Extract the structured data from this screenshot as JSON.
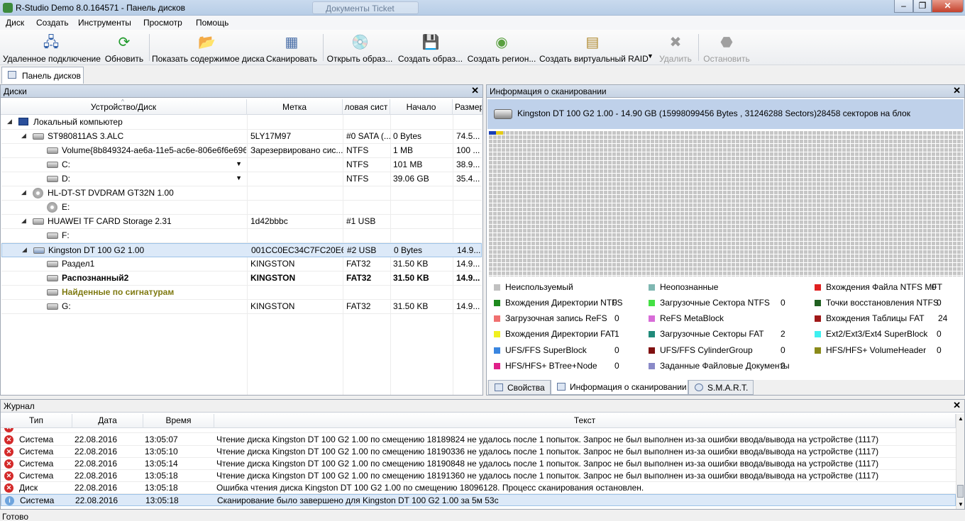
{
  "window": {
    "title": "R-Studio Demo 8.0.164571 - Панель дисков",
    "ghost_tab": "Документы Ticket",
    "controls": [
      "–",
      "❐",
      "✕"
    ]
  },
  "menu": [
    "Диск",
    "Создать",
    "Инструменты",
    "Просмотр",
    "Помощь"
  ],
  "toolbar": [
    {
      "label": "Удаленное подключение",
      "icon": "remote-computer-icon",
      "disabled": false
    },
    {
      "label": "Обновить",
      "icon": "refresh-icon",
      "disabled": false
    },
    {
      "label": "Показать содержимое диска",
      "icon": "open-folder-icon",
      "disabled": false
    },
    {
      "label": "Сканировать",
      "icon": "scan-icon",
      "disabled": false
    },
    {
      "label": "Открыть образ...",
      "icon": "open-image-icon",
      "disabled": false
    },
    {
      "label": "Создать образ...",
      "icon": "create-image-icon",
      "disabled": false
    },
    {
      "label": "Создать регион...",
      "icon": "create-region-icon",
      "disabled": false
    },
    {
      "label": "Создать виртуальный RAID",
      "icon": "virtual-raid-icon",
      "disabled": false
    },
    {
      "label": "Удалить",
      "icon": "delete-icon",
      "disabled": true
    },
    {
      "label": "Остановить",
      "icon": "stop-icon",
      "disabled": true
    }
  ],
  "doc_tab": "Панель дисков",
  "disks_pane": {
    "title": "Диски",
    "columns": [
      "Устройство/Диск",
      "Метка",
      "ловая сист",
      "Начало",
      "Размер"
    ],
    "rows": [
      {
        "name": "Локальный компьютер",
        "label": "",
        "fs": "",
        "start": "",
        "size": ""
      },
      {
        "name": "ST980811AS 3.ALC",
        "label": "5LY17M97",
        "fs": "#0 SATA (...",
        "start": "0 Bytes",
        "size": "74.5..."
      },
      {
        "name": "Volume{8b849324-ae6a-11e5-ac6e-806e6f6e6963}",
        "label": "Зарезервировано сис...",
        "fs": "NTFS",
        "start": "1 MB",
        "size": "100 ..."
      },
      {
        "name": "C:",
        "label": "",
        "fs": "NTFS",
        "start": "101 MB",
        "size": "38.9..."
      },
      {
        "name": "D:",
        "label": "",
        "fs": "NTFS",
        "start": "39.06 GB",
        "size": "35.4..."
      },
      {
        "name": "HL-DT-ST DVDRAM GT32N 1.00",
        "label": "",
        "fs": "",
        "start": "",
        "size": ""
      },
      {
        "name": "E:",
        "label": "",
        "fs": "",
        "start": "",
        "size": ""
      },
      {
        "name": "HUAWEI TF CARD Storage 2.31",
        "label": "1d42bbbc",
        "fs": "#1 USB",
        "start": "",
        "size": ""
      },
      {
        "name": "F:",
        "label": "",
        "fs": "",
        "start": "",
        "size": ""
      },
      {
        "name": "Kingston DT 100 G2 1.00",
        "label": "001CC0EC34C7FC20E6...",
        "fs": "#2 USB",
        "start": "0 Bytes",
        "size": "14.9..."
      },
      {
        "name": "Раздел1",
        "label": "KINGSTON",
        "fs": "FAT32",
        "start": "31.50 KB",
        "size": "14.9..."
      },
      {
        "name": "Распознанный2",
        "label": "KINGSTON",
        "fs": "FAT32",
        "start": "31.50 KB",
        "size": "14.9..."
      },
      {
        "name": "Найденные по сигнатурам",
        "label": "",
        "fs": "",
        "start": "",
        "size": ""
      },
      {
        "name": "G:",
        "label": "KINGSTON",
        "fs": "FAT32",
        "start": "31.50 KB",
        "size": "14.9..."
      }
    ]
  },
  "scan_pane": {
    "title": "Информация о сканировании",
    "device": "Kingston DT 100 G2 1.00 - 14.90 GB (15998099456 Bytes , 31246288 Sectors)28458 секторов на блок",
    "legend": [
      {
        "text": "Неиспользуемый",
        "count": "",
        "color": "#c0c0c0"
      },
      {
        "text": "Неопознанные",
        "count": "",
        "color": "#7fb7b2"
      },
      {
        "text": "Вхождения Файла NTFS MFT",
        "count": "0",
        "color": "#e02020"
      },
      {
        "text": "Вхождения Директории NTFS",
        "count": "0",
        "color": "#1e8a1e"
      },
      {
        "text": "Загрузочные Сектора NTFS",
        "count": "0",
        "color": "#44e044"
      },
      {
        "text": "Точки восстановления NTFS",
        "count": "0",
        "color": "#206020"
      },
      {
        "text": "Загрузочная запись ReFS",
        "count": "0",
        "color": "#f07070"
      },
      {
        "text": "ReFS MetaBlock",
        "count": "",
        "color": "#d86cd8"
      },
      {
        "text": "Вхождения Таблицы FAT",
        "count": "24",
        "color": "#a01818"
      },
      {
        "text": "Вхождения Директории FAT",
        "count": "1",
        "color": "#f0f020"
      },
      {
        "text": "Загрузочные Секторы FAT",
        "count": "2",
        "color": "#208a7a"
      },
      {
        "text": "Ext2/Ext3/Ext4 SuperBlock",
        "count": "0",
        "color": "#3ef0f0"
      },
      {
        "text": "UFS/FFS SuperBlock",
        "count": "0",
        "color": "#3a86e0"
      },
      {
        "text": "UFS/FFS CylinderGroup",
        "count": "0",
        "color": "#801010"
      },
      {
        "text": "HFS/HFS+ VolumeHeader",
        "count": "0",
        "color": "#8a8a1a"
      },
      {
        "text": "HFS/HFS+ BTree+Node",
        "count": "0",
        "color": "#e0208a"
      },
      {
        "text": "Заданные Файловые Документы",
        "count": "2",
        "color": "#8a8ac8"
      }
    ],
    "tabs": [
      "Свойства",
      "Информация о сканировании",
      "S.M.A.R.T."
    ]
  },
  "log": {
    "title": "Журнал",
    "columns": [
      "Тип",
      "Дата",
      "Время",
      "Текст"
    ],
    "rows": [
      {
        "type": "Система",
        "date": "22.08.2016",
        "time": "13:05:07",
        "text": "Чтение диска Kingston DT 100 G2 1.00 по смещению 18189824 не удалось после 1 попыток. Запрос не был выполнен из-за ошибки ввода/вывода на устройстве (1117)",
        "kind": "error"
      },
      {
        "type": "Система",
        "date": "22.08.2016",
        "time": "13:05:10",
        "text": "Чтение диска Kingston DT 100 G2 1.00 по смещению 18190336 не удалось после 1 попыток. Запрос не был выполнен из-за ошибки ввода/вывода на устройстве (1117)",
        "kind": "error"
      },
      {
        "type": "Система",
        "date": "22.08.2016",
        "time": "13:05:14",
        "text": "Чтение диска Kingston DT 100 G2 1.00 по смещению 18190848 не удалось после 1 попыток. Запрос не был выполнен из-за ошибки ввода/вывода на устройстве (1117)",
        "kind": "error"
      },
      {
        "type": "Система",
        "date": "22.08.2016",
        "time": "13:05:18",
        "text": "Чтение диска Kingston DT 100 G2 1.00 по смещению 18191360 не удалось после 1 попыток. Запрос не был выполнен из-за ошибки ввода/вывода на устройстве (1117)",
        "kind": "error"
      },
      {
        "type": "Диск",
        "date": "22.08.2016",
        "time": "13:05:18",
        "text": "Ошибка чтения диска Kingston DT 100 G2 1.00 по смещению 18096128. Процесс сканирования остановлен.",
        "kind": "error"
      },
      {
        "type": "Система",
        "date": "22.08.2016",
        "time": "13:05:18",
        "text": "Сканирование было завершено для Kingston DT 100 G2 1.00 за 5м 53с",
        "kind": "info"
      }
    ]
  },
  "status": "Готово"
}
